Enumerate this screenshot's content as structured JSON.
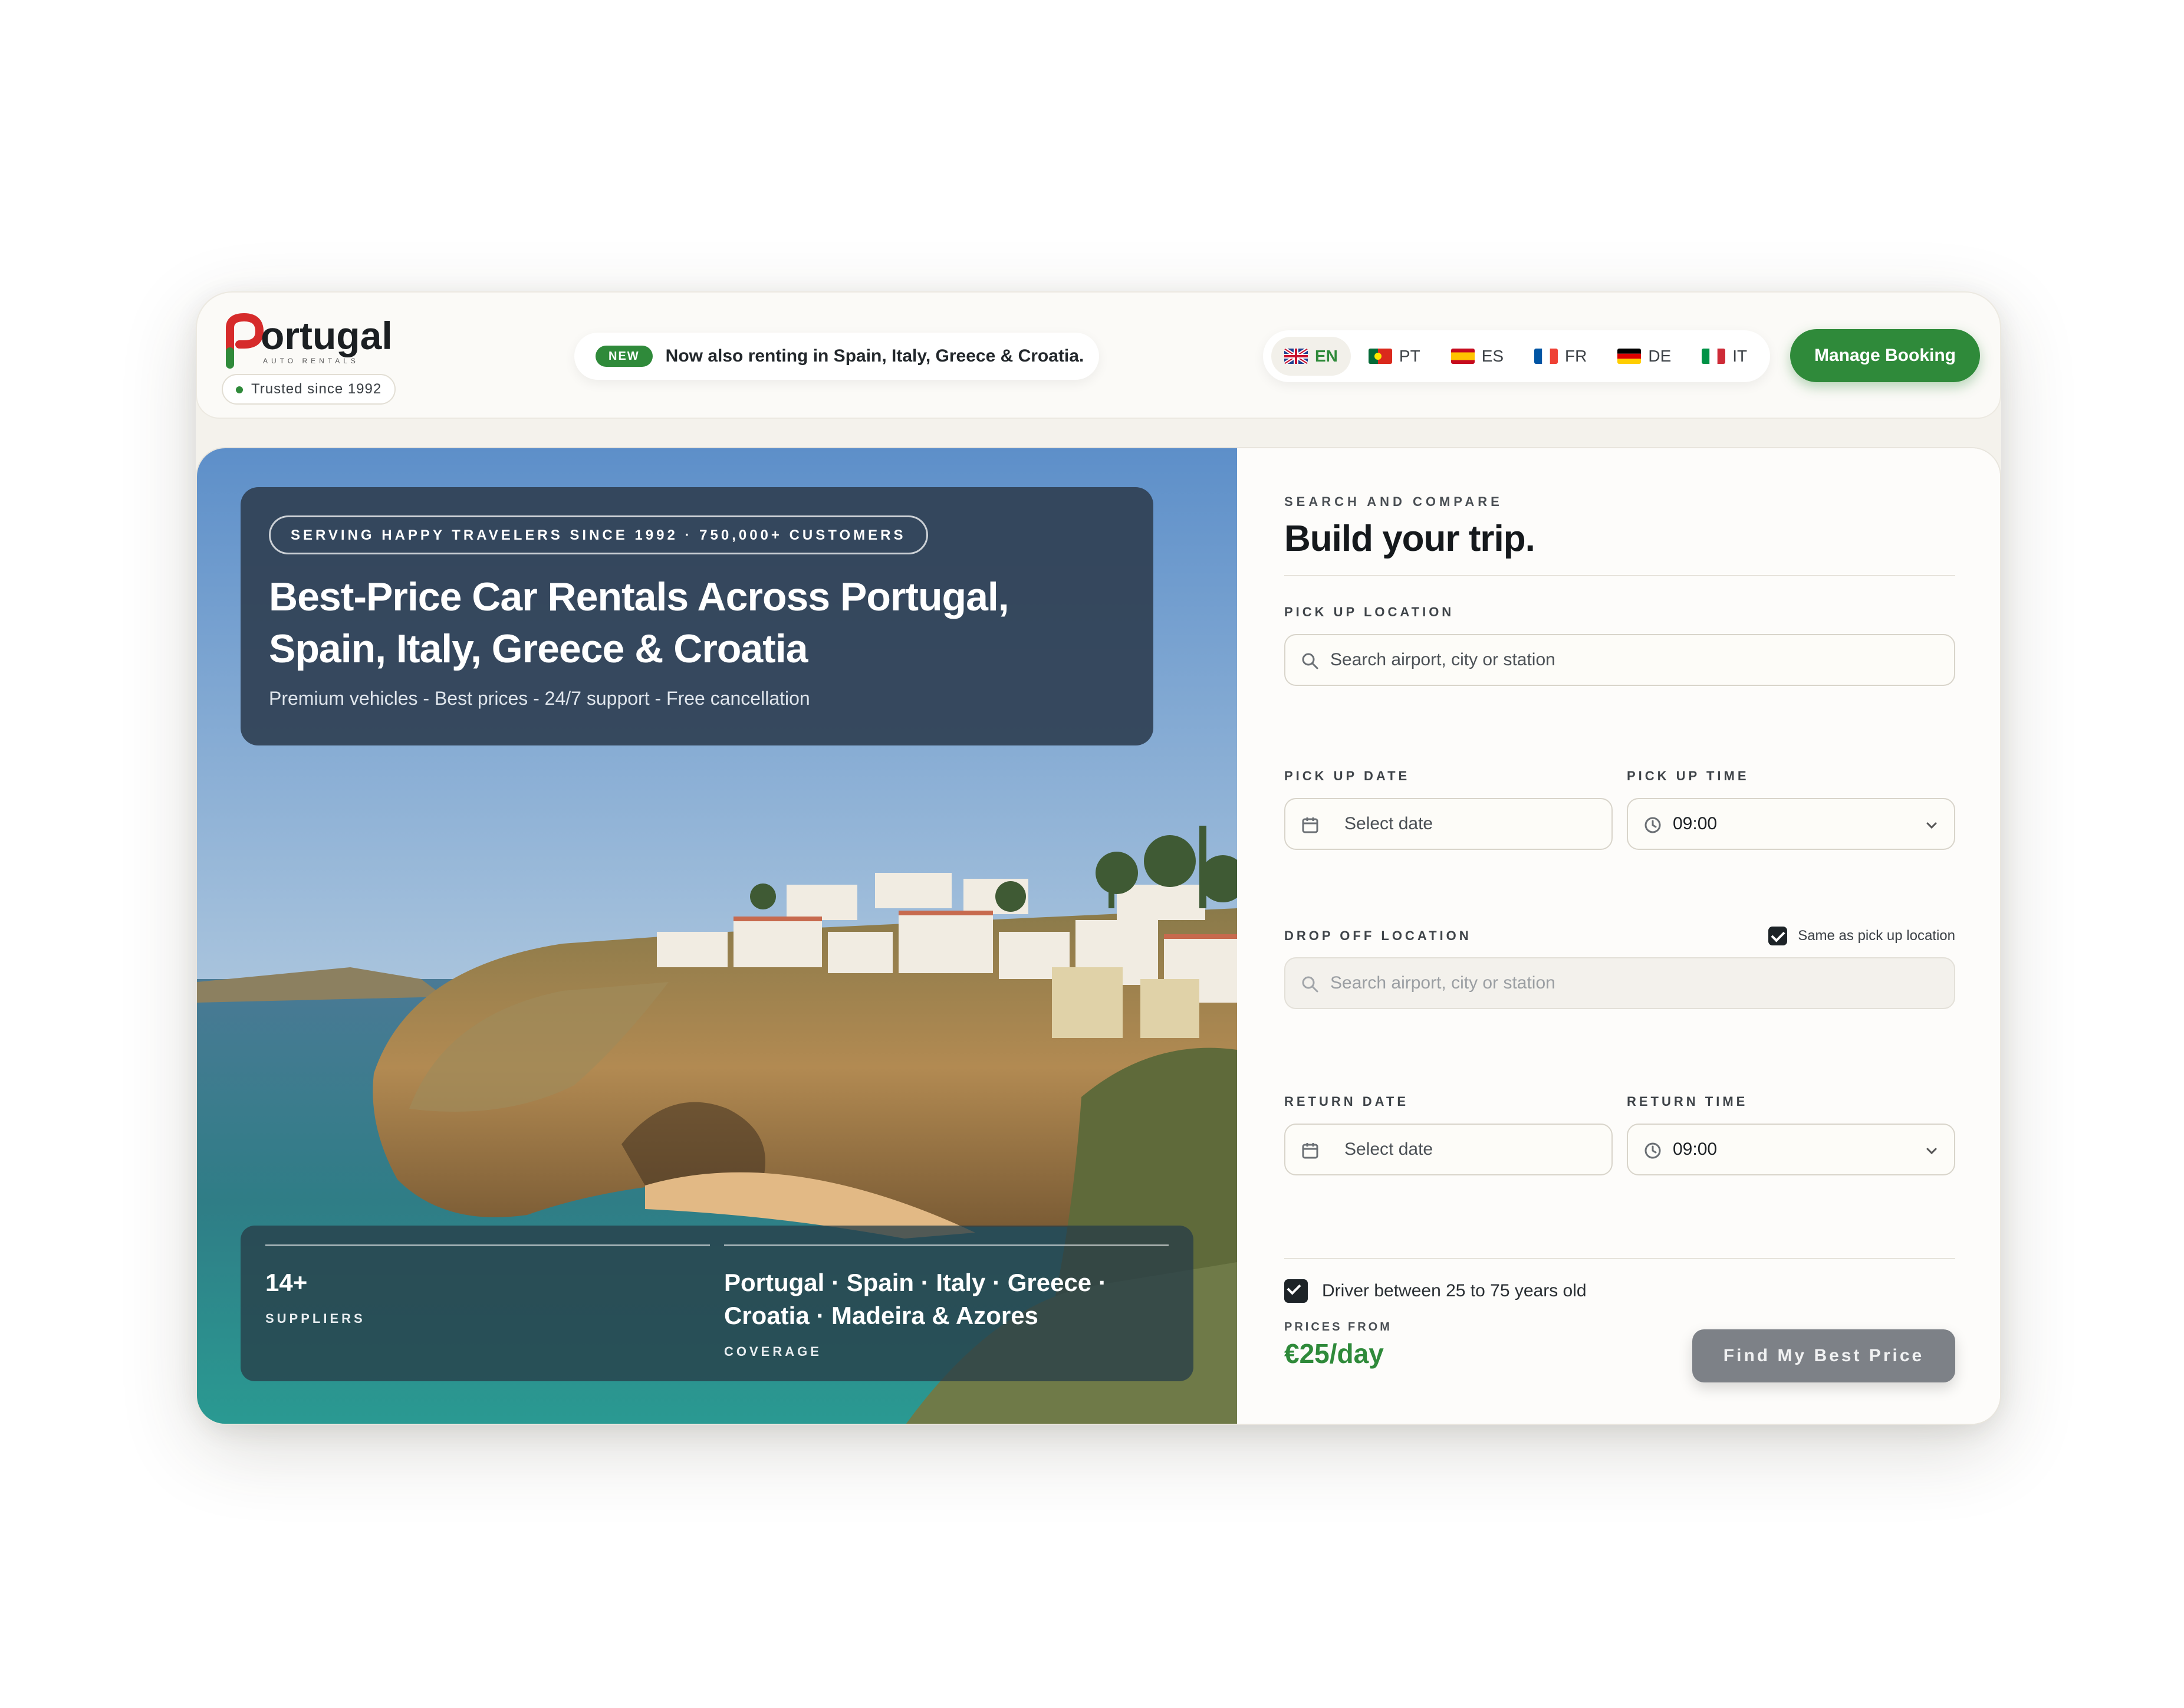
{
  "header": {
    "logo_text": "Portugal",
    "logo_subtext": "AUTO RENTALS",
    "trusted_label": "Trusted since 1992",
    "announcement_badge": "NEW",
    "announcement_text": "Now also renting in Spain, Italy, Greece & Croatia.",
    "languages": [
      {
        "code": "EN",
        "flag": "uk-flag-icon",
        "active": true
      },
      {
        "code": "PT",
        "flag": "portugal-flag-icon",
        "active": false
      },
      {
        "code": "ES",
        "flag": "spain-flag-icon",
        "active": false
      },
      {
        "code": "FR",
        "flag": "france-flag-icon",
        "active": false
      },
      {
        "code": "DE",
        "flag": "germany-flag-icon",
        "active": false
      },
      {
        "code": "IT",
        "flag": "italy-flag-icon",
        "active": false
      }
    ],
    "manage_booking_label": "Manage Booking"
  },
  "hero": {
    "pill_text": "SERVING HAPPY TRAVELERS SINCE 1992 · 750,000+ CUSTOMERS",
    "title_line1": "Best-Price Car Rentals Across Portugal,",
    "title_line2": "Spain, Italy, Greece & Croatia",
    "subtitle": "Premium vehicles - Best prices - 24/7 support - Free cancellation",
    "stats": [
      {
        "value": "14+",
        "label": "SUPPLIERS"
      },
      {
        "value_line1": "Portugal · Spain · Italy · Greece ·",
        "value_line2": "Croatia · Madeira & Azores",
        "label": "COVERAGE"
      }
    ]
  },
  "form": {
    "eyebrow": "SEARCH AND COMPARE",
    "title": "Build your trip.",
    "pickup_location_label": "PICK UP LOCATION",
    "pickup_location_placeholder": "Search airport, city or station",
    "pickup_date_label": "PICK UP DATE",
    "pickup_date_placeholder": "Select date",
    "pickup_time_label": "PICK UP TIME",
    "pickup_time_value": "09:00",
    "dropoff_location_label": "DROP OFF LOCATION",
    "same_as_pickup_label": "Same as pick up location",
    "same_as_pickup_checked": true,
    "dropoff_location_placeholder": "Search airport, city or station",
    "return_date_label": "RETURN DATE",
    "return_date_placeholder": "Select date",
    "return_time_label": "RETURN TIME",
    "return_time_value": "09:00",
    "driver_age_label": "Driver between 25 to 75 years old",
    "driver_age_checked": true,
    "prices_from_label": "PRICES FROM",
    "price_value": "€25/day",
    "find_button_label": "Find My Best Price"
  },
  "colors": {
    "brand_green": "#2f8a3a",
    "logo_red": "#d62b2b",
    "hero_card": "#304054",
    "button_gray": "#7d8187"
  }
}
